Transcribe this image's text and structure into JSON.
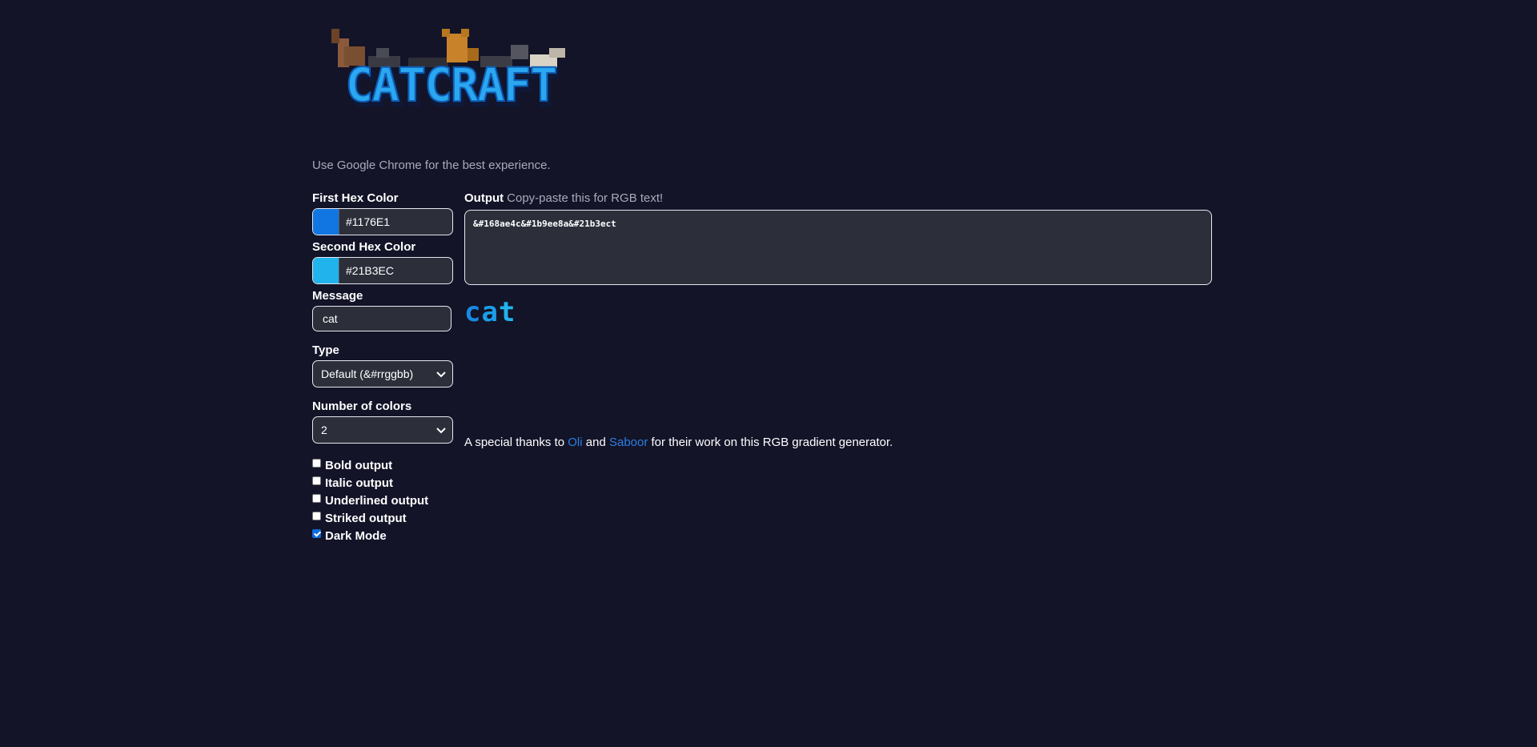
{
  "logo": {
    "text": "CATCRAFT"
  },
  "hint": "Use Google Chrome for the best experience.",
  "form": {
    "first_color": {
      "label": "First Hex Color",
      "value": "#1176E1",
      "swatch": "#1176E1"
    },
    "second_color": {
      "label": "Second Hex Color",
      "value": "#21B3EC",
      "swatch": "#21B3EC"
    },
    "message": {
      "label": "Message",
      "value": "cat"
    },
    "type": {
      "label": "Type",
      "selected": "Default (&#rrggbb)"
    },
    "num_colors": {
      "label": "Number of colors",
      "selected": "2"
    },
    "checkboxes": [
      {
        "label": "Bold output",
        "checked": false
      },
      {
        "label": "Italic output",
        "checked": false
      },
      {
        "label": "Underlined output",
        "checked": false
      },
      {
        "label": "Striked output",
        "checked": false
      },
      {
        "label": "Dark Mode",
        "checked": true
      }
    ]
  },
  "output": {
    "label": "Output",
    "sublabel": "Copy-paste this for RGB text!",
    "value": "&#168ae4c&#1b9ee8a&#21b3ect",
    "preview_chars": [
      {
        "char": "c",
        "color": "#168ae4"
      },
      {
        "char": "a",
        "color": "#1b9ee8"
      },
      {
        "char": "t",
        "color": "#21b3ec"
      }
    ]
  },
  "thanks": {
    "prefix": "A special thanks to",
    "name1": "Oli",
    "and": "and",
    "name2": "Saboor",
    "suffix": "for their work on this RGB gradient generator."
  },
  "colors": {
    "background": "#131428",
    "field_bg": "#2c2f3a",
    "link": "#2e7ee0"
  }
}
